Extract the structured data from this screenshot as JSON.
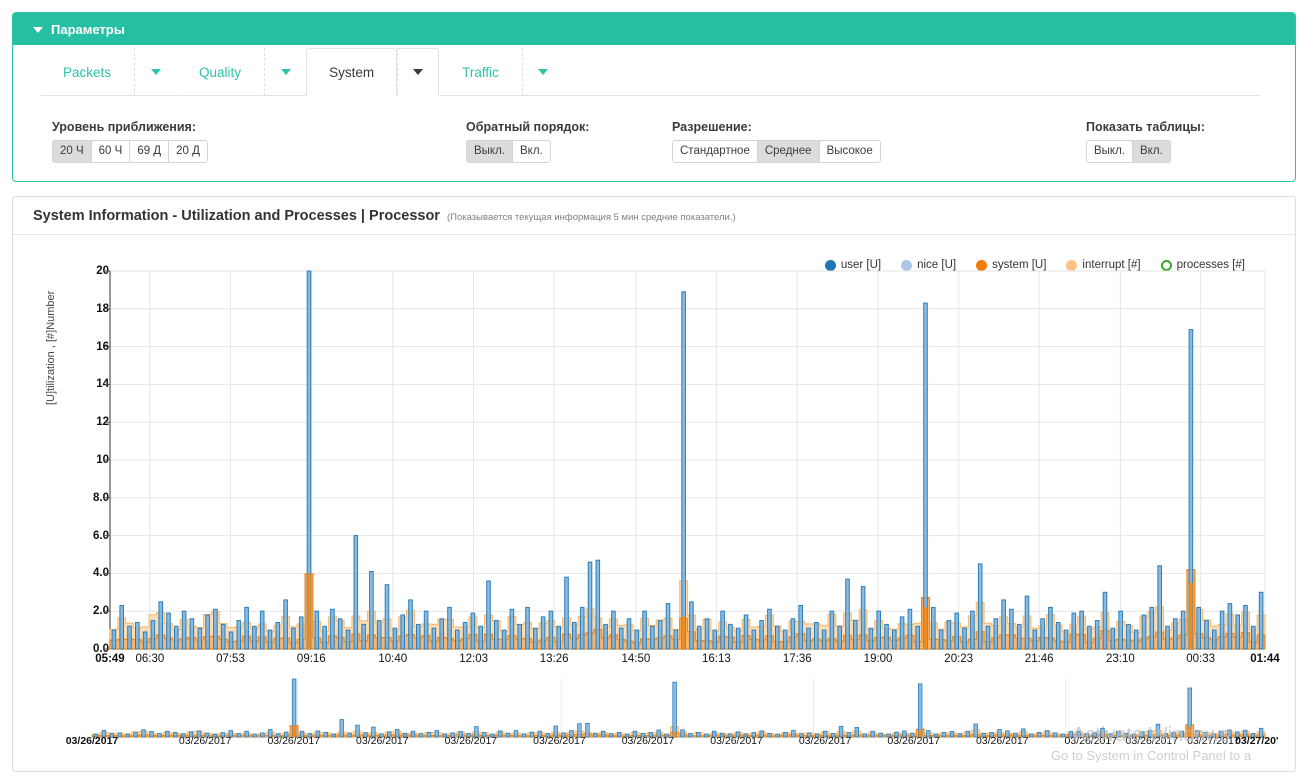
{
  "panel": {
    "header_title": "Параметры",
    "header_icon": "chevron-down-icon",
    "accent_color": "#26bfa3"
  },
  "tabs": [
    {
      "label": "Packets",
      "active": false
    },
    {
      "label": "Quality",
      "active": false
    },
    {
      "label": "System",
      "active": true
    },
    {
      "label": "Traffic",
      "active": false
    }
  ],
  "options": {
    "zoom": {
      "label": "Уровень приближения:",
      "buttons": [
        "20 Ч",
        "60 Ч",
        "69 Д",
        "20 Д"
      ],
      "selected": "20 Ч"
    },
    "reverse": {
      "label": "Обратный порядок:",
      "buttons": [
        "Выкл.",
        "Вкл."
      ],
      "selected": "Выкл."
    },
    "resolution": {
      "label": "Разрешение:",
      "buttons": [
        "Стандартное",
        "Среднее",
        "Высокое"
      ],
      "selected": "Среднее"
    },
    "tables": {
      "label": "Показать таблицы:",
      "buttons": [
        "Выкл.",
        "Вкл."
      ],
      "selected": "Вкл."
    }
  },
  "chart_panel": {
    "title": "System Information - Utilization and Processes | Processor",
    "subtitle": "(Показывается текущая информация 5 мин средние показатели.)"
  },
  "watermark": {
    "title": "Activate Windows",
    "subtitle": "Go to System in Control Panel to a"
  },
  "chart_data": {
    "type": "bar",
    "title": "System Information - Utilization and Processes | Processor",
    "xlabel": "",
    "ylabel": "[U]tilization , [#]Number",
    "ylim": [
      0,
      20
    ],
    "grid": true,
    "legend_position": "top-right",
    "ytick_labels": [
      "0.0",
      "2.0",
      "4.0",
      "6.0",
      "8.0",
      "10",
      "12",
      "14",
      "16",
      "18",
      "20"
    ],
    "yticks": [
      0,
      2,
      4,
      6,
      8,
      10,
      12,
      14,
      16,
      18,
      20
    ],
    "xtick_labels": [
      "05:49",
      "06:30",
      "07:53",
      "09:16",
      "10:40",
      "12:03",
      "13:26",
      "14:50",
      "16:13",
      "17:36",
      "19:00",
      "20:23",
      "21:46",
      "23:10",
      "00:33",
      "01:44"
    ],
    "xtick_positions": [
      0.0,
      0.0345,
      0.1043,
      0.1743,
      0.2448,
      0.3148,
      0.3845,
      0.4553,
      0.525,
      0.595,
      0.665,
      0.7348,
      0.8045,
      0.8748,
      0.9443,
      1.0
    ],
    "series": [
      {
        "name": "user [U]",
        "color": "#1f77b4",
        "style": "bar"
      },
      {
        "name": "nice [U]",
        "color": "#aec7e8",
        "style": "bar"
      },
      {
        "name": "system [U]",
        "color": "#f07d0a",
        "style": "area"
      },
      {
        "name": "interrupt [#]",
        "color": "#ffc285",
        "style": "area"
      },
      {
        "name": "processes [#]",
        "color": "#3aa82d",
        "style": "line"
      }
    ],
    "user_values": [
      1.0,
      2.3,
      1.2,
      1.4,
      0.9,
      1.5,
      2.5,
      1.9,
      1.2,
      2.0,
      1.6,
      1.1,
      1.8,
      2.1,
      1.3,
      0.9,
      1.5,
      2.2,
      1.2,
      2.0,
      1.0,
      1.4,
      2.6,
      1.1,
      1.7,
      20.0,
      2.0,
      1.2,
      2.1,
      1.6,
      1.0,
      6.0,
      1.3,
      4.1,
      1.5,
      3.4,
      1.1,
      1.8,
      2.6,
      1.3,
      2.0,
      1.1,
      1.6,
      2.2,
      1.0,
      1.4,
      1.9,
      1.2,
      3.6,
      1.5,
      1.0,
      2.1,
      1.3,
      2.2,
      1.1,
      1.7,
      2.0,
      1.2,
      3.8,
      1.4,
      2.2,
      4.6,
      4.7,
      1.3,
      2.0,
      1.1,
      1.6,
      1.0,
      2.0,
      1.2,
      1.5,
      2.4,
      1.0,
      18.9,
      2.5,
      1.2,
      1.6,
      1.0,
      2.0,
      1.3,
      1.1,
      1.8,
      1.0,
      1.5,
      2.1,
      1.2,
      1.0,
      1.6,
      2.3,
      1.1,
      1.4,
      1.0,
      2.0,
      1.2,
      3.7,
      1.5,
      3.3,
      1.1,
      2.0,
      1.3,
      1.0,
      1.7,
      2.1,
      1.2,
      18.3,
      2.2,
      1.0,
      1.5,
      1.9,
      1.1,
      2.0,
      4.5,
      1.2,
      1.6,
      2.6,
      2.1,
      1.3,
      2.8,
      1.0,
      1.6,
      2.2,
      1.4,
      1.0,
      1.9,
      2.0,
      1.2,
      1.5,
      3.0,
      1.1,
      2.0,
      1.3,
      1.0,
      1.8,
      2.2,
      4.4,
      1.2,
      1.6,
      2.0,
      16.9,
      2.2,
      1.5,
      1.0,
      2.0,
      2.4,
      1.8,
      2.3,
      1.2,
      3.0
    ],
    "system_values": [
      0.5,
      0.6,
      0.4,
      0.5,
      0.4,
      0.6,
      0.7,
      0.5,
      0.4,
      0.6,
      0.5,
      0.4,
      0.6,
      0.7,
      0.5,
      0.4,
      0.5,
      0.6,
      0.4,
      0.6,
      0.4,
      0.5,
      0.7,
      0.4,
      0.6,
      4.0,
      0.6,
      0.4,
      0.6,
      0.5,
      0.4,
      0.8,
      0.5,
      0.7,
      0.5,
      0.7,
      0.4,
      0.6,
      0.7,
      0.5,
      0.6,
      0.4,
      0.5,
      0.6,
      0.4,
      0.5,
      0.6,
      0.4,
      0.8,
      0.5,
      0.4,
      0.6,
      0.5,
      0.6,
      0.4,
      0.5,
      0.6,
      0.4,
      0.7,
      0.5,
      0.6,
      0.8,
      0.8,
      0.5,
      0.6,
      0.4,
      0.5,
      0.4,
      0.6,
      0.4,
      0.5,
      0.7,
      0.4,
      1.7,
      0.7,
      0.4,
      0.5,
      0.4,
      0.6,
      0.5,
      0.4,
      0.6,
      0.4,
      0.5,
      0.6,
      0.4,
      0.4,
      0.5,
      0.7,
      0.4,
      0.5,
      0.4,
      0.6,
      0.4,
      0.8,
      0.5,
      0.7,
      0.4,
      0.6,
      0.5,
      0.4,
      0.5,
      0.6,
      0.4,
      2.2,
      0.6,
      0.4,
      0.5,
      0.6,
      0.4,
      0.6,
      0.9,
      0.4,
      0.5,
      0.7,
      0.6,
      0.5,
      0.7,
      0.4,
      0.5,
      0.6,
      0.5,
      0.4,
      0.6,
      0.6,
      0.4,
      0.5,
      0.8,
      0.4,
      0.6,
      0.5,
      0.4,
      0.6,
      0.7,
      0.9,
      0.4,
      0.5,
      0.6,
      3.5,
      0.7,
      0.5,
      0.4,
      0.6,
      0.7,
      0.5,
      0.7,
      0.4,
      0.8
    ],
    "interrupt_values": [
      1.2,
      1.4,
      1.1,
      1.3,
      1.0,
      1.5,
      1.6,
      1.2,
      1.1,
      1.4,
      1.3,
      1.0,
      1.5,
      1.7,
      1.2,
      1.0,
      1.3,
      1.5,
      1.1,
      1.4,
      1.0,
      1.2,
      1.6,
      1.1,
      1.4,
      1.5,
      1.4,
      1.1,
      1.5,
      1.3,
      1.0,
      1.8,
      1.2,
      1.6,
      1.3,
      1.7,
      1.1,
      1.4,
      1.7,
      1.2,
      1.5,
      1.1,
      1.3,
      1.5,
      1.0,
      1.3,
      1.5,
      1.1,
      1.9,
      1.3,
      1.0,
      1.5,
      1.2,
      1.5,
      1.1,
      1.3,
      1.5,
      1.1,
      1.6,
      1.3,
      1.5,
      1.8,
      1.9,
      1.2,
      1.5,
      1.1,
      1.3,
      1.0,
      1.5,
      1.1,
      1.3,
      1.7,
      1.0,
      3.7,
      1.7,
      1.1,
      1.3,
      1.0,
      1.5,
      1.2,
      1.1,
      1.5,
      1.0,
      1.3,
      1.5,
      1.1,
      1.0,
      1.3,
      1.7,
      1.1,
      1.3,
      1.0,
      1.5,
      1.1,
      1.9,
      1.3,
      1.8,
      1.1,
      1.5,
      1.2,
      1.0,
      1.3,
      1.5,
      1.1,
      2.0,
      1.5,
      1.0,
      1.3,
      1.5,
      1.1,
      1.5,
      2.0,
      1.1,
      1.3,
      1.7,
      1.5,
      1.2,
      1.8,
      1.0,
      1.3,
      1.5,
      1.2,
      1.0,
      1.5,
      1.5,
      1.1,
      1.3,
      1.9,
      1.0,
      1.5,
      1.2,
      1.0,
      1.5,
      1.7,
      2.0,
      1.1,
      1.3,
      1.5,
      2.1,
      1.7,
      1.3,
      1.0,
      1.5,
      1.8,
      1.3,
      1.7,
      1.1,
      1.9
    ],
    "nice_values": [
      0.8,
      0.9,
      0.7,
      0.8,
      0.6,
      0.9,
      1.0,
      0.8,
      0.7,
      0.9,
      0.8,
      0.6,
      0.9,
      1.0,
      0.8,
      0.6,
      0.8,
      0.9,
      0.7,
      0.9,
      0.6,
      0.8,
      1.0,
      0.7,
      0.9,
      1.0,
      0.9,
      0.7,
      0.9,
      0.8,
      0.6,
      1.1,
      0.8,
      1.0,
      0.8,
      1.0,
      0.7,
      0.9,
      1.0,
      0.8,
      0.9,
      0.7,
      0.8,
      0.9,
      0.6,
      0.8,
      0.9,
      0.7,
      1.2,
      0.8,
      0.6,
      0.9,
      0.8,
      0.9,
      0.7,
      0.8,
      0.9,
      0.7,
      1.0,
      0.8,
      0.9,
      1.1,
      1.2,
      0.8,
      0.9,
      0.7,
      0.8,
      0.6,
      0.9,
      0.7,
      0.8,
      1.0,
      0.6,
      1.2,
      1.0,
      0.7,
      0.8,
      0.6,
      0.9,
      0.8,
      0.7,
      0.9,
      0.6,
      0.8,
      0.9,
      0.7,
      0.6,
      0.8,
      1.0,
      0.7,
      0.8,
      0.6,
      0.9,
      0.7,
      1.2,
      0.8,
      1.1,
      0.7,
      0.9,
      0.8,
      0.6,
      0.8,
      0.9,
      0.7,
      1.2,
      0.9,
      0.6,
      0.8,
      0.9,
      0.7,
      0.9,
      1.2,
      0.7,
      0.8,
      1.0,
      0.9,
      0.8,
      1.1,
      0.6,
      0.8,
      0.9,
      0.8,
      0.6,
      0.9,
      0.9,
      0.7,
      0.8,
      1.1,
      0.6,
      0.9,
      0.8,
      0.6,
      0.9,
      1.0,
      1.2,
      0.7,
      0.8,
      0.9,
      1.3,
      1.0,
      0.8,
      0.6,
      0.9,
      1.1,
      0.8,
      1.0,
      0.7,
      1.1
    ]
  },
  "navigator": {
    "date_labels": [
      "03/26/2017",
      "03/26/2017",
      "03/26/2017",
      "03/26/2017",
      "03/26/2017",
      "03/26/2017",
      "03/26/2017",
      "03/26/2017",
      "03/26/2017",
      "03/26/2017",
      "03/26/2017",
      "03/26/2017",
      "03/26/2017",
      "03/27/2017",
      "03/27/20'"
    ],
    "date_positions": [
      0.0,
      0.0965,
      0.172,
      0.2475,
      0.323,
      0.3985,
      0.474,
      0.5495,
      0.625,
      0.7005,
      0.776,
      0.8515,
      0.9035,
      0.956,
      0.993
    ]
  }
}
